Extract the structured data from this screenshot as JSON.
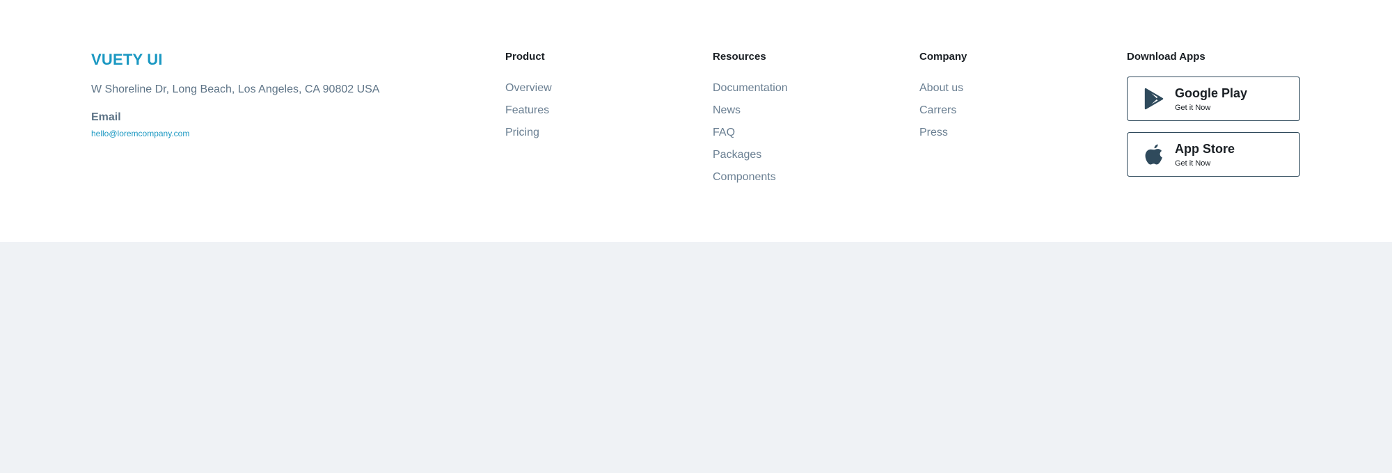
{
  "brand": {
    "logo": "VUETY UI",
    "address": "W Shoreline Dr, Long Beach, Los Angeles, CA 90802 USA",
    "email_label": "Email",
    "email": "hello@loremcompany.com"
  },
  "columns": {
    "product": {
      "heading": "Product",
      "links": [
        "Overview",
        "Features",
        "Pricing"
      ]
    },
    "resources": {
      "heading": "Resources",
      "links": [
        "Documentation",
        "News",
        "FAQ",
        "Packages",
        "Components"
      ]
    },
    "company": {
      "heading": "Company",
      "links": [
        "About us",
        "Carrers",
        "Press"
      ]
    }
  },
  "apps": {
    "heading": "Download Apps",
    "google": {
      "name": "Google Play",
      "sub": "Get it Now",
      "icon": "google-play-icon"
    },
    "apple": {
      "name": "App Store",
      "sub": "Get it Now",
      "icon": "apple-icon"
    }
  },
  "colors": {
    "brand": "#1b98c2",
    "text_muted": "#5e7487",
    "heading": "#1a1f24",
    "icon": "#2f4a5c",
    "page_bg": "#eff2f5"
  }
}
